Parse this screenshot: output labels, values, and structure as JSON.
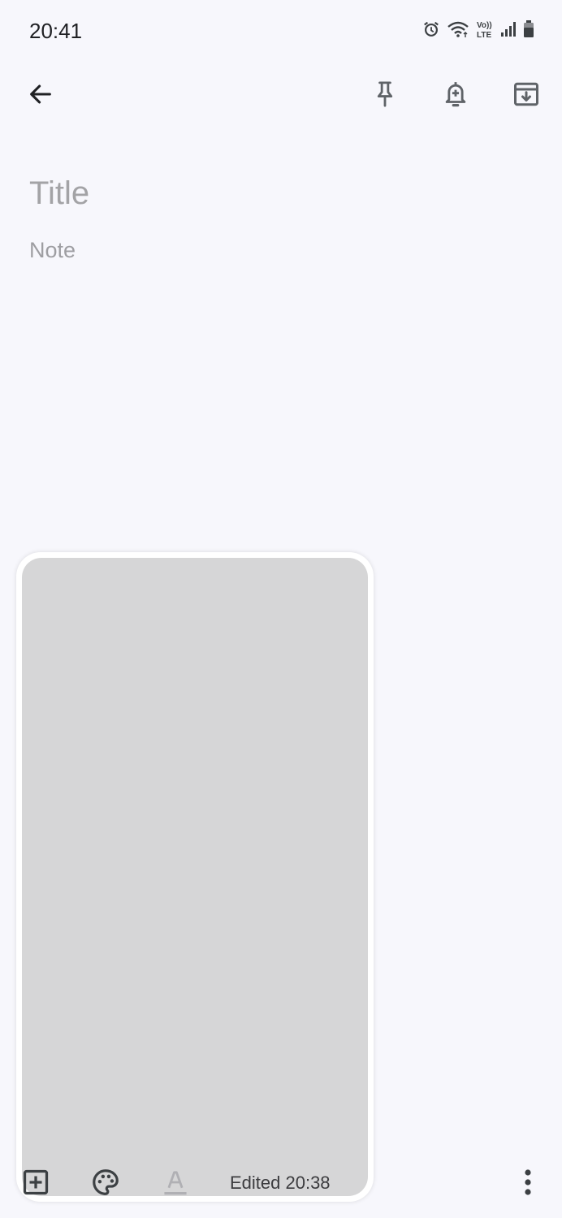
{
  "status_bar": {
    "time": "20:41",
    "icons": [
      "alarm-icon",
      "wifi-icon",
      "volte-icon",
      "signal-icon",
      "battery-icon"
    ],
    "volte_text": "Vo)) LTE"
  },
  "toolbar": {
    "back_icon": "arrow-left-icon",
    "pin_icon": "pin-icon",
    "reminder_icon": "bell-plus-icon",
    "archive_icon": "archive-icon"
  },
  "note": {
    "title_placeholder": "Title",
    "body_placeholder": "Note"
  },
  "bottom_bar": {
    "add_icon": "add-box-icon",
    "palette_icon": "palette-icon",
    "format_icon": "text-format-icon",
    "edited_text": "Edited 20:38",
    "more_icon": "more-vert-icon"
  },
  "colors": {
    "background": "#f7f7fc",
    "overlay": "#d6d6d7",
    "icon": "#5f6368"
  }
}
